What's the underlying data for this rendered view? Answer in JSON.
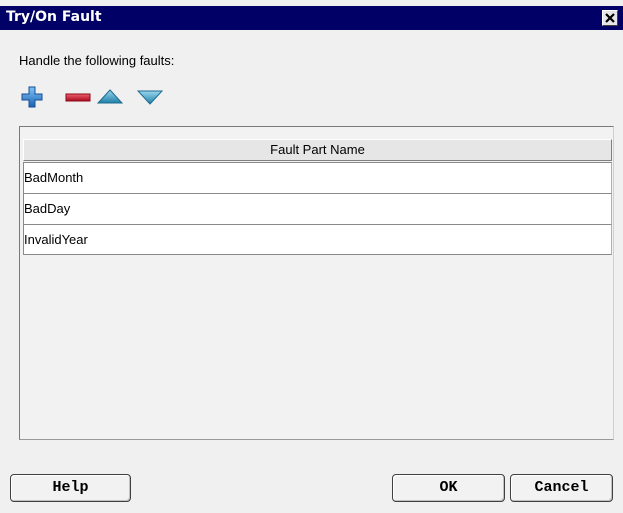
{
  "window": {
    "title": "Try/On Fault",
    "close_label": "✕"
  },
  "prompt": "Handle the following faults:",
  "toolbar": {
    "icons": [
      "add-icon",
      "remove-icon",
      "move-up-icon",
      "move-down-icon"
    ],
    "colors": {
      "add": "#2a7fd0",
      "remove": "#cc1122",
      "arrows": "#2f8fb8"
    }
  },
  "table": {
    "column_header": "Fault Part Name",
    "rows": [
      "BadMonth",
      "BadDay",
      "InvalidYear"
    ]
  },
  "buttons": {
    "help": "Help",
    "ok": "OK",
    "cancel": "Cancel"
  },
  "colors": {
    "titlebar": "#000066",
    "dialog_background": "#f0f0f0"
  }
}
